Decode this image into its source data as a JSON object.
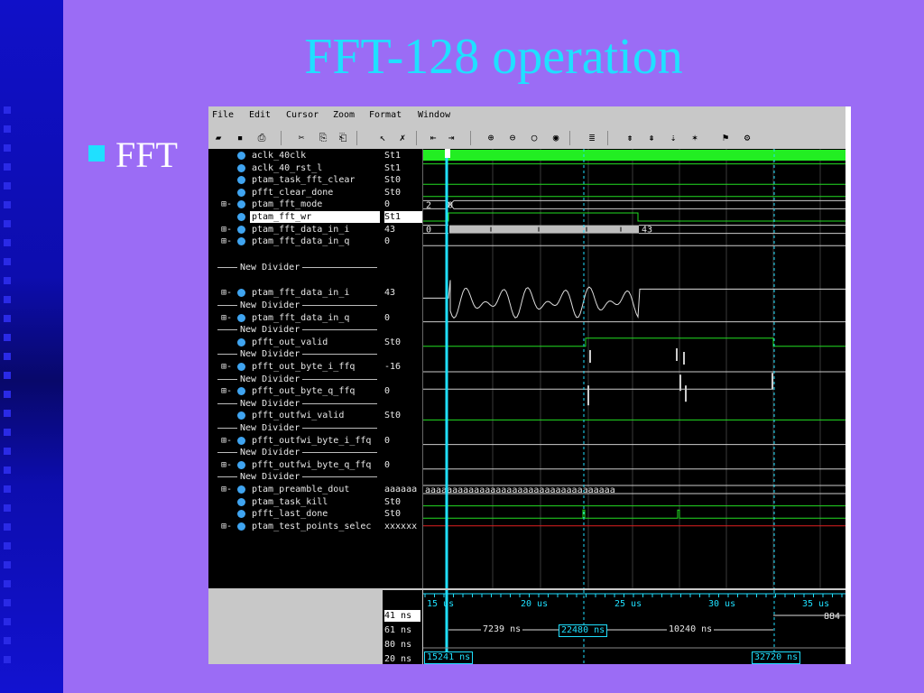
{
  "slide": {
    "title": "FFT-128 operation",
    "bullet": "FFT"
  },
  "menu": [
    "File",
    "Edit",
    "Cursor",
    "Zoom",
    "Format",
    "Window"
  ],
  "menu_mnemonics": [
    "F",
    "E",
    "C",
    "Z",
    "o",
    "W"
  ],
  "toolbar_icons": [
    "open-icon",
    "save-icon",
    "print-icon",
    "cut-icon",
    "copy-icon",
    "paste-icon",
    "select-pointer-icon",
    "delete-icon",
    "zoom-full-icon",
    "zoom-range-icon",
    "zoom-in-icon",
    "zoom-out-icon",
    "zoom-fit-icon",
    "zoom-area-icon",
    "find-icon",
    "edge-prev-icon",
    "edge-next-icon",
    "edge-search-icon",
    "marker-icon",
    "breakpoint-icon",
    "signal-add-icon"
  ],
  "signals": [
    {
      "type": "signal",
      "name": "aclk_40clk",
      "value": "St1",
      "expand": false
    },
    {
      "type": "signal",
      "name": "aclk_40_rst_l",
      "value": "St1",
      "expand": false
    },
    {
      "type": "signal",
      "name": "ptam_task_fft_clear",
      "value": "St0",
      "expand": false
    },
    {
      "type": "signal",
      "name": "pfft_clear_done",
      "value": "St0",
      "expand": false
    },
    {
      "type": "signal",
      "name": "ptam_fft_mode",
      "value": "0",
      "expand": true
    },
    {
      "type": "signal",
      "name": "ptam_fft_wr",
      "value": "St1",
      "expand": false,
      "selected": true
    },
    {
      "type": "signal",
      "name": "ptam_fft_data_in_i",
      "value": "43",
      "expand": true
    },
    {
      "type": "signal",
      "name": "ptam_fft_data_in_q",
      "value": "0",
      "expand": true
    },
    {
      "type": "spacer"
    },
    {
      "type": "divider",
      "name": "New Divider"
    },
    {
      "type": "spacer"
    },
    {
      "type": "signal",
      "name": "ptam_fft_data_in_i",
      "value": "43",
      "expand": true
    },
    {
      "type": "divider",
      "name": "New Divider"
    },
    {
      "type": "signal",
      "name": "ptam_fft_data_in_q",
      "value": "0",
      "expand": true
    },
    {
      "type": "divider",
      "name": "New Divider"
    },
    {
      "type": "signal",
      "name": "pfft_out_valid",
      "value": "St0",
      "expand": false
    },
    {
      "type": "divider",
      "name": "New Divider"
    },
    {
      "type": "signal",
      "name": "pfft_out_byte_i_ffq",
      "value": "-16",
      "expand": true
    },
    {
      "type": "divider",
      "name": "New Divider"
    },
    {
      "type": "signal",
      "name": "pfft_out_byte_q_ffq",
      "value": "0",
      "expand": true
    },
    {
      "type": "divider",
      "name": "New Divider"
    },
    {
      "type": "signal",
      "name": "pfft_outfwi_valid",
      "value": "St0",
      "expand": false
    },
    {
      "type": "divider",
      "name": "New Divider"
    },
    {
      "type": "signal",
      "name": "pfft_outfwi_byte_i_ffq",
      "value": "0",
      "expand": true
    },
    {
      "type": "divider",
      "name": "New Divider"
    },
    {
      "type": "signal",
      "name": "pfft_outfwi_byte_q_ffq",
      "value": "0",
      "expand": true
    },
    {
      "type": "divider",
      "name": "New Divider"
    },
    {
      "type": "signal",
      "name": "ptam_preamble_dout",
      "value": "aaaaaa",
      "expand": true
    },
    {
      "type": "signal",
      "name": "ptam_task_kill",
      "value": "St0",
      "expand": false
    },
    {
      "type": "signal",
      "name": "pfft_last_done",
      "value": "St0",
      "expand": false
    },
    {
      "type": "signal",
      "name": "ptam_test_points_selec",
      "value": "xxxxxx",
      "expand": true
    }
  ],
  "wave_text": {
    "mode_value_a": "2",
    "mode_value_b": "0",
    "data_in_i_start": "0",
    "data_in_i_end": "43",
    "preamble_bus": "aaaaaaaaaaaaaaaaaaaaaaaaaaaaaaaaaaa"
  },
  "timeline": {
    "ticks": [
      "15 us",
      "20 us",
      "25 us",
      "30 us",
      "35 us"
    ],
    "cursor_values": [
      "41 ns",
      "61 ns",
      "80 ns",
      "20 ns"
    ],
    "right_value": "884",
    "delta_1": "7239 ns",
    "delta_2": "22480 ns",
    "delta_3": "10240 ns",
    "cursor_a": "15241 ns",
    "cursor_b": "32720 ns"
  },
  "colors": {
    "background": "#9b6cf5",
    "title": "#1fe0ff",
    "wave_green": "#22dd22",
    "cursor_cyan": "#1fe0ff",
    "test_red": "#e02020"
  }
}
